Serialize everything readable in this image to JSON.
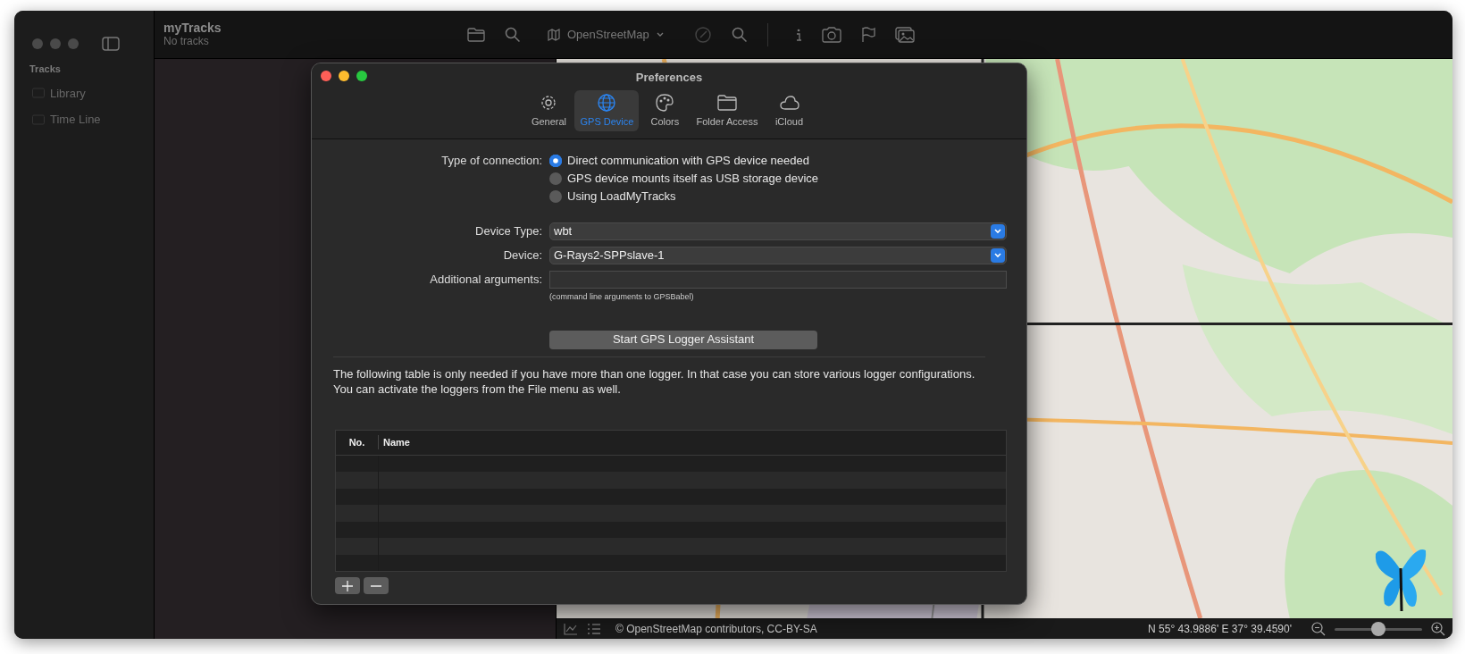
{
  "window": {
    "title": "myTracks",
    "subtitle": "No tracks"
  },
  "sidebar": {
    "heading": "Tracks",
    "items": [
      {
        "label": "Library",
        "selected": false
      },
      {
        "label": "Time Line",
        "selected": false
      }
    ]
  },
  "toolbar": {
    "map_source": "OpenStreetMap"
  },
  "preferences": {
    "title": "Preferences",
    "tabs": [
      {
        "label": "General",
        "selected": false
      },
      {
        "label": "GPS Device",
        "selected": true
      },
      {
        "label": "Colors",
        "selected": false
      },
      {
        "label": "Folder Access",
        "selected": false
      },
      {
        "label": "iCloud",
        "selected": false
      }
    ],
    "connection_label": "Type of connection:",
    "connection_options": [
      {
        "label": "Direct communication with GPS device needed",
        "selected": true
      },
      {
        "label": "GPS device mounts itself as USB storage device",
        "selected": false
      },
      {
        "label": "Using LoadMyTracks",
        "selected": false
      }
    ],
    "device_type": {
      "label": "Device Type:",
      "value": "wbt"
    },
    "device": {
      "label": "Device:",
      "value": "G-Rays2-SPPslave-1"
    },
    "additional_arguments": {
      "label": "Additional arguments:",
      "hint": "(command line arguments to GPSBabel)"
    },
    "assistant_button": "Start GPS Logger Assistant",
    "description": "The following table is only needed if you have more than one logger. In that case you can store various logger configurations. You can activate the loggers from the File menu as well.",
    "table": {
      "columns": [
        "No.",
        "Name"
      ]
    }
  },
  "status_bar": {
    "attribution": "© OpenStreetMap contributors, CC-BY-SA",
    "coordinates": "N 55° 43.9886' E 37° 39.4590'",
    "zoom": {
      "level": 0.5
    }
  }
}
